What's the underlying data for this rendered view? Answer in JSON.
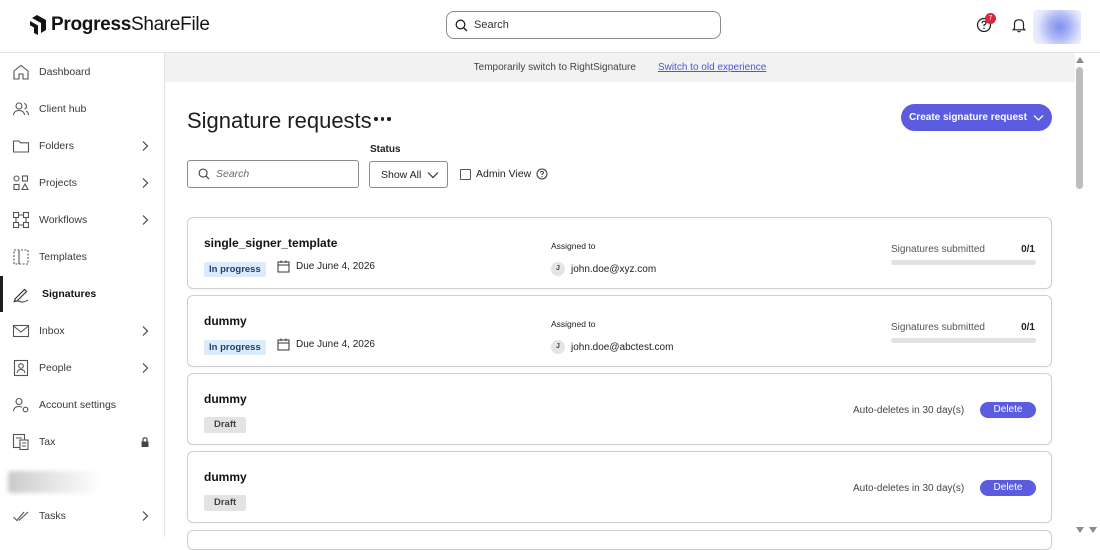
{
  "header": {
    "logo_brand": "Progress",
    "logo_product": "ShareFile",
    "search_placeholder": "Search",
    "help_badge_count": "7",
    "icons": {
      "search": "search-icon",
      "help": "help-icon",
      "notifications": "bell-icon"
    }
  },
  "sidebar": {
    "items": [
      {
        "label": "Dashboard",
        "icon": "home-icon",
        "chevron": false
      },
      {
        "label": "Client hub",
        "icon": "people-icon",
        "chevron": false
      },
      {
        "label": "Folders",
        "icon": "folder-icon",
        "chevron": true
      },
      {
        "label": "Projects",
        "icon": "projects-icon",
        "chevron": true
      },
      {
        "label": "Workflows",
        "icon": "workflow-icon",
        "chevron": true
      },
      {
        "label": "Templates",
        "icon": "template-icon",
        "chevron": false
      },
      {
        "label": "Signatures",
        "icon": "pen-icon",
        "chevron": false,
        "active": true
      },
      {
        "label": "Inbox",
        "icon": "envelope-icon",
        "chevron": true
      },
      {
        "label": "People",
        "icon": "contact-icon",
        "chevron": true
      },
      {
        "label": "Account settings",
        "icon": "settings-icon",
        "chevron": false
      },
      {
        "label": "Tax",
        "icon": "tax-icon",
        "locked": true
      },
      {
        "label": "Tasks",
        "icon": "check-icon",
        "chevron": true
      }
    ]
  },
  "banner": {
    "text": "Temporarily switch to RightSignature",
    "link": "Switch to old experience"
  },
  "main": {
    "title": "Signature requests",
    "create_button": "Create signature request",
    "search_placeholder": "Search",
    "status_label": "Status",
    "status_value": "Show All",
    "admin_view_label": "Admin View"
  },
  "requests": [
    {
      "name": "single_signer_template",
      "status": "In progress",
      "due": "Due June 4, 2026",
      "assigned_label": "Assigned to",
      "assignee_initial": "J",
      "assignee": "john.doe@xyz.com",
      "signatures_label": "Signatures submitted",
      "signatures": "0/1",
      "progress": 0
    },
    {
      "name": "dummy",
      "status": "In progress",
      "due": "Due June 4, 2026",
      "assigned_label": "Assigned to",
      "assignee_initial": "J",
      "assignee": "john.doe@abctest.com",
      "signatures_label": "Signatures submitted",
      "signatures": "0/1",
      "progress": 0
    },
    {
      "name": "dummy",
      "status": "Draft",
      "auto_delete": "Auto-deletes in 30 day(s)",
      "delete_label": "Delete"
    },
    {
      "name": "dummy",
      "status": "Draft",
      "auto_delete": "Auto-deletes in 30 day(s)",
      "delete_label": "Delete"
    }
  ],
  "colors": {
    "accent": "#5b5ce0",
    "in_progress_bg": "#dcebfb",
    "draft_bg": "#e3e3e3"
  }
}
